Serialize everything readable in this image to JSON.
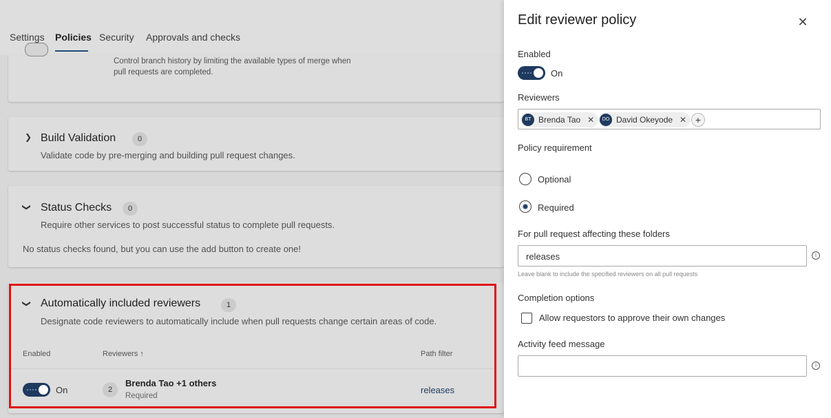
{
  "tabs": [
    "Settings",
    "Policies",
    "Security",
    "Approvals and checks"
  ],
  "merge_card": {
    "desc_line1": "Control branch history by limiting the available types of merge when",
    "desc_line2": "pull requests are completed."
  },
  "build_card": {
    "title": "Build Validation",
    "count": "0",
    "desc": "Validate code by pre-merging and building pull request changes."
  },
  "status_card": {
    "title": "Status Checks",
    "count": "0",
    "desc": "Require other services to post successful status to complete pull requests.",
    "empty": "No status checks found, but you can use the add button to create one!"
  },
  "reviewers_card": {
    "title": "Automatically included reviewers",
    "count": "1",
    "desc": "Designate code reviewers to automatically include when pull requests change certain areas of code.",
    "columns": [
      "Enabled",
      "Reviewers ↑",
      "Path filter"
    ],
    "row": {
      "enabled_text": "On",
      "reviewer_count": "2",
      "reviewers": "Brenda Tao +1 others",
      "requirement": "Required",
      "path": "releases"
    }
  },
  "panel": {
    "title": "Edit reviewer policy",
    "enabled_label": "Enabled",
    "enabled_value": "On",
    "reviewers_label": "Reviewers",
    "reviewers": [
      {
        "initials": "BT",
        "name": "Brenda Tao"
      },
      {
        "initials": "DO",
        "name": "David Okeyode"
      }
    ],
    "requirement_label": "Policy requirement",
    "options": [
      "Optional",
      "Required"
    ],
    "folders_label": "For pull request affecting these folders",
    "folders_value": "releases",
    "folders_helper": "Leave blank to include the specified reviewers on all pull requests",
    "completion_label": "Completion options",
    "completion_option": "Allow requestors to approve their own changes",
    "activity_label": "Activity feed message",
    "activity_value": ""
  },
  "colors": {
    "accent": "#1f3a5f",
    "highlight": "#e01010"
  }
}
